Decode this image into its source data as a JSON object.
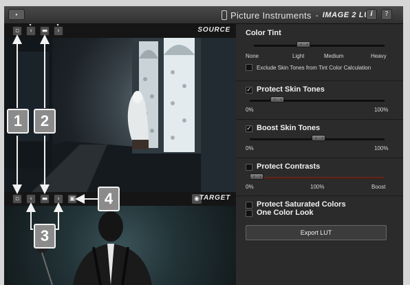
{
  "window": {
    "brand": "Picture Instruments",
    "separator": "-",
    "product": "IMAGE 2 LUT",
    "info_label": "i",
    "help_label": "?"
  },
  "left_panel": {
    "source_label": "SOURCE",
    "target_label": "TARGET"
  },
  "callouts": [
    "1",
    "2",
    "3",
    "4"
  ],
  "controls": {
    "color_tint": {
      "title": "Color Tint",
      "ticks": [
        "None",
        "Light",
        "Medium",
        "Heavy"
      ],
      "value": 0.33,
      "exclude_label": "Exclude Skin Tones from Tint Color Calculation",
      "exclude_checked": false
    },
    "protect_skin": {
      "label": "Protect Skin Tones",
      "checked": true,
      "min_label": "0%",
      "max_label": "100%",
      "value": 0.22
    },
    "boost_skin": {
      "label": "Boost Skin Tones",
      "checked": true,
      "min_label": "0%",
      "max_label": "100%",
      "value": 0.5
    },
    "protect_contrasts": {
      "label": "Protect Contrasts",
      "checked": false,
      "min_label": "0%",
      "mid_label": "100%",
      "max_label": "Boost",
      "value": 0.04
    },
    "protect_saturated": {
      "label": "Protect Saturated Colors",
      "checked": false
    },
    "one_color": {
      "label": "One Color Look",
      "checked": false
    },
    "export_label": "Export LUT"
  },
  "colors": {
    "accent_track": "#6a2d22",
    "callout_fill": "#8b8b8b"
  }
}
